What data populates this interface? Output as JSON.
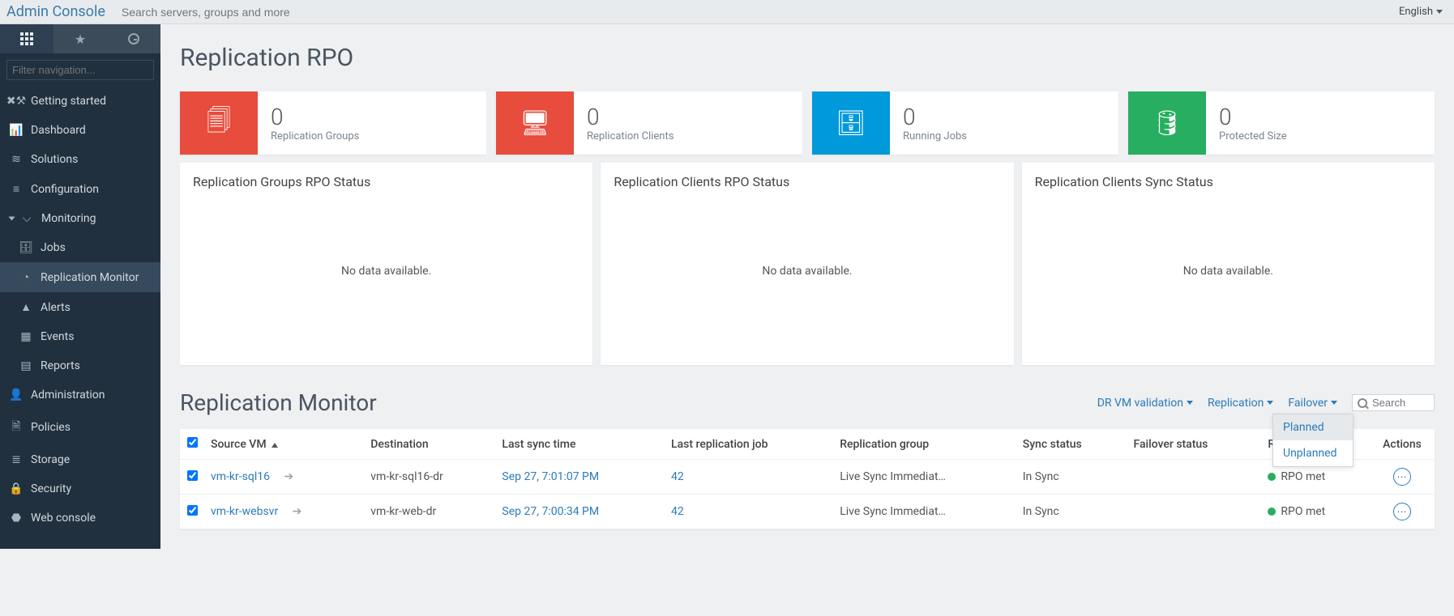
{
  "brand": "Admin Console",
  "search_placeholder": "Search servers, groups and more",
  "language": "English",
  "nav_filter_placeholder": "Filter navigation...",
  "sidebar": {
    "items": [
      {
        "label": "Getting started",
        "icon": "tools"
      },
      {
        "label": "Dashboard",
        "icon": "chart"
      },
      {
        "label": "Solutions",
        "icon": "layers"
      },
      {
        "label": "Configuration",
        "icon": "sliders"
      },
      {
        "label": "Monitoring",
        "icon": "monitor",
        "expanded": true,
        "children": [
          {
            "label": "Jobs",
            "icon": "briefcase"
          },
          {
            "label": "Replication Monitor",
            "icon": "gauge",
            "active": true
          },
          {
            "label": "Alerts",
            "icon": "alert"
          },
          {
            "label": "Events",
            "icon": "calendar"
          },
          {
            "label": "Reports",
            "icon": "report"
          }
        ]
      },
      {
        "label": "Administration",
        "icon": "admin"
      },
      {
        "label": "Policies",
        "icon": "policy"
      },
      {
        "label": "Storage",
        "icon": "storage"
      },
      {
        "label": "Security",
        "icon": "lock"
      },
      {
        "label": "Web console",
        "icon": "cube"
      }
    ]
  },
  "page_title": "Replication RPO",
  "stats": [
    {
      "value": "0",
      "label": "Replication Groups",
      "color": "red",
      "icon": "copies"
    },
    {
      "value": "0",
      "label": "Replication Clients",
      "color": "red",
      "icon": "server-copy"
    },
    {
      "value": "0",
      "label": "Running Jobs",
      "color": "blue",
      "icon": "briefcase"
    },
    {
      "value": "0",
      "label": "Protected Size",
      "color": "green",
      "icon": "db-shield"
    }
  ],
  "panels": [
    {
      "title": "Replication Groups RPO Status",
      "body": "No data available."
    },
    {
      "title": "Replication Clients RPO Status",
      "body": "No data available."
    },
    {
      "title": "Replication Clients Sync Status",
      "body": "No data available."
    }
  ],
  "monitor": {
    "title": "Replication Monitor",
    "actions": {
      "dr_vm": "DR VM validation",
      "replication": "Replication",
      "failover": "Failover",
      "dropdown": [
        {
          "label": "Planned",
          "hover": true
        },
        {
          "label": "Unplanned",
          "hover": false
        }
      ],
      "search_placeholder": "Search"
    },
    "columns": [
      "Source VM",
      "Destination",
      "Last sync time",
      "Last replication job",
      "Replication group",
      "Sync status",
      "Failover status",
      "RPO status",
      "Actions"
    ],
    "rows": [
      {
        "source": "vm-kr-sql16",
        "dest": "vm-kr-sql16-dr",
        "last_sync": "Sep 27, 7:01:07 PM",
        "last_job": "42",
        "group": "Live Sync Immediat…",
        "sync": "In Sync",
        "failover": "",
        "rpo": "RPO met"
      },
      {
        "source": "vm-kr-websvr",
        "dest": "vm-kr-web-dr",
        "last_sync": "Sep 27, 7:00:34 PM",
        "last_job": "42",
        "group": "Live Sync Immediat…",
        "sync": "In Sync",
        "failover": "",
        "rpo": "RPO met"
      }
    ]
  }
}
